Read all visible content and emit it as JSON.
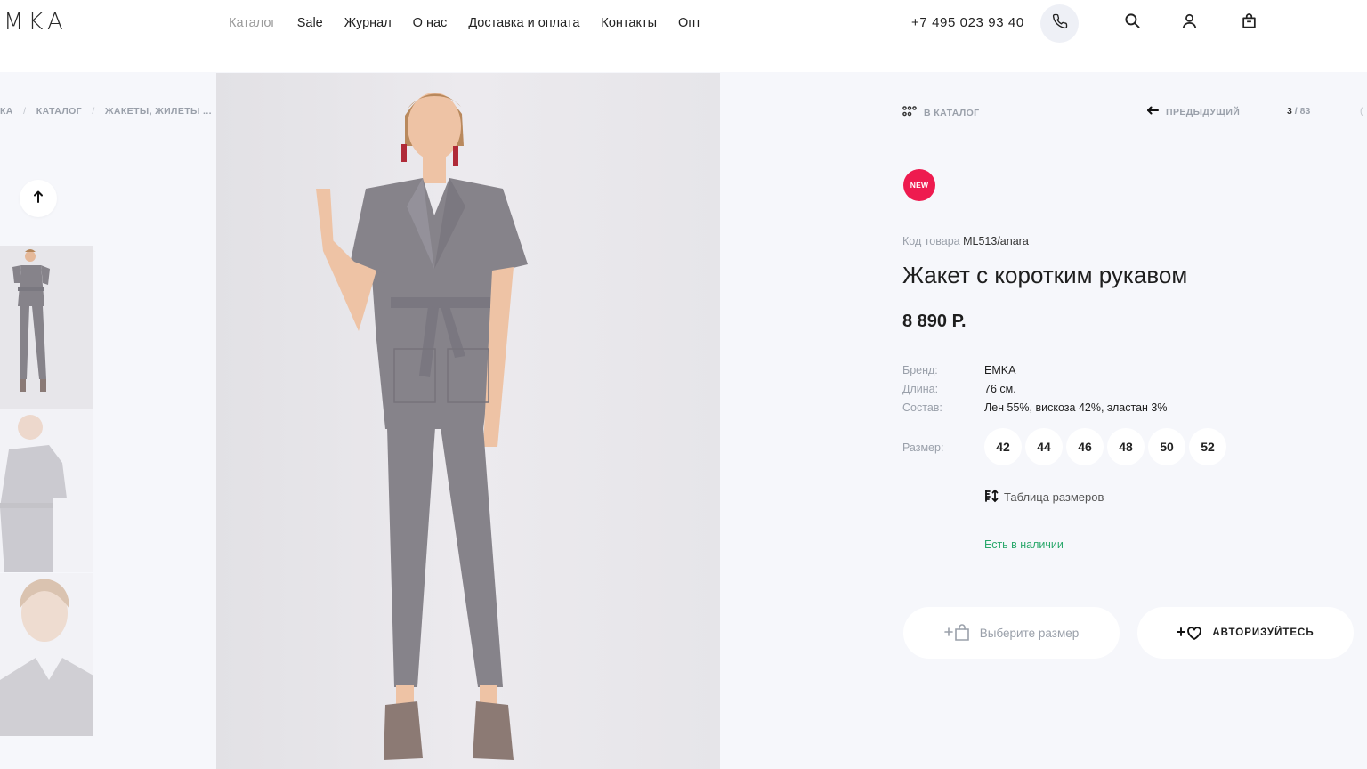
{
  "header": {
    "logo": "MKA",
    "nav": [
      "Каталог",
      "Sale",
      "Журнал",
      "О нас",
      "Доставка и оплата",
      "Контакты",
      "Опт"
    ],
    "active_nav": "Каталог",
    "phone": "+7 495 023 93 40",
    "icons": [
      "phone-icon",
      "search-icon",
      "user-icon",
      "cart-icon"
    ]
  },
  "breadcrumbs": [
    "КА",
    "КАТАЛОГ",
    "ЖАКЕТЫ, ЖИЛЕТЫ ..."
  ],
  "breadcrumb_separator": "/",
  "product_nav": {
    "to_catalog": "В КАТАЛОГ",
    "prev": "ПРЕДЫДУЩИЙ",
    "current": "3",
    "sep": "/",
    "total": "83",
    "edge": "("
  },
  "product": {
    "badge": "NEW",
    "sku_label": "Код товара",
    "sku": "ML513/anara",
    "title": "Жакет с коротким рукавом",
    "price": "8 890 Р.",
    "specs": [
      {
        "label": "Бренд:",
        "value": "EMKA"
      },
      {
        "label": "Длина:",
        "value": "76 см."
      },
      {
        "label": "Состав:",
        "value": "Лен 55%, вискоза 42%, эластан 3%"
      }
    ],
    "size_label": "Размер:",
    "sizes": [
      "42",
      "44",
      "46",
      "48",
      "50",
      "52"
    ],
    "size_table": "Таблица размеров",
    "stock": "Есть в наличии",
    "choose_size_button": "Выберите размер",
    "auth_button": "АВТОРИЗУЙТЕСЬ"
  },
  "colors": {
    "badge": "#ee1b4f",
    "stock": "#2aa86b",
    "background": "#f6f7fb",
    "suit": "#86838a"
  }
}
